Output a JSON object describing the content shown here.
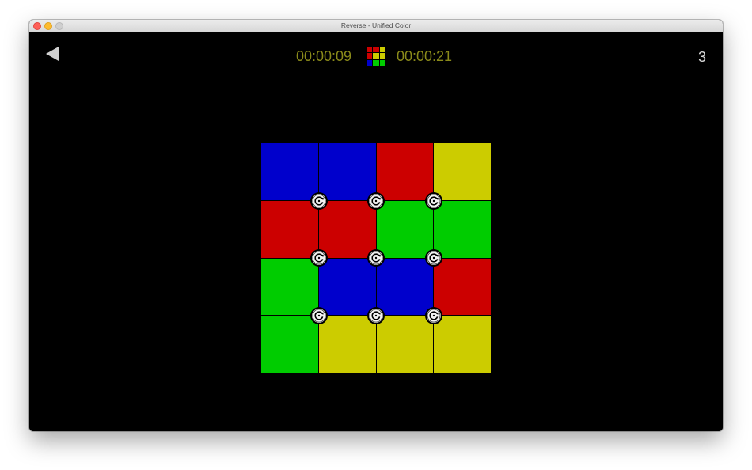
{
  "window": {
    "title": "Reverse - Unified Color"
  },
  "hud": {
    "elapsed_time": "00:00:09",
    "best_time": "00:00:21",
    "moves": "3"
  },
  "icons": {
    "back": "back-arrow-icon",
    "logo": "color-grid-logo-icon",
    "rotate": "rotate-icon"
  },
  "colors": {
    "red": "#cc0000",
    "blue": "#0000cc",
    "green": "#00cc00",
    "yellow": "#cccc00",
    "timer": "#8a8a1a"
  },
  "logo_grid": [
    [
      "red",
      "red",
      "yellow"
    ],
    [
      "red",
      "yellow",
      "yellow"
    ],
    [
      "blue",
      "green",
      "green"
    ]
  ],
  "board": {
    "rows": [
      [
        "blue",
        "blue",
        "red",
        "yellow"
      ],
      [
        "red",
        "red",
        "green",
        "green"
      ],
      [
        "green",
        "blue",
        "blue",
        "red"
      ],
      [
        "green",
        "yellow",
        "yellow",
        "yellow"
      ]
    ],
    "rotators_per_side": 3
  }
}
